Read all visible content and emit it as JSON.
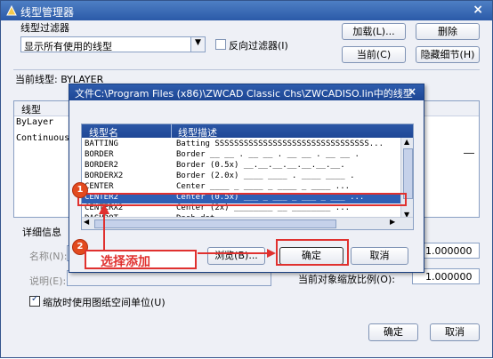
{
  "window": {
    "title": "线型管理器",
    "close_glyph": "×"
  },
  "filter": {
    "group_label": "线型过滤器",
    "selected": "显示所有使用的线型",
    "invert_label": "反向过滤器(I)"
  },
  "buttons": {
    "load": "加载(L)...",
    "delete": "删除",
    "current": "当前(C)",
    "hide_details": "隐藏细节(H)",
    "ok": "确定",
    "cancel": "取消"
  },
  "current_linetype": "当前线型: BYLAYER",
  "main_list": {
    "header": "线型",
    "rows": [
      "ByLayer",
      "Continuous"
    ]
  },
  "details": {
    "group_label": "详细信息",
    "name_label": "名称(N):",
    "desc_label": "说明(E):",
    "global_scale_value": "1.000000",
    "current_scale_label": "当前对象缩放比例(O):",
    "current_scale_value": "1.000000",
    "paper_units_label": "缩放时使用图纸空间单位(U)"
  },
  "dialog": {
    "title": "文件C:\\Program Files (x86)\\ZWCAD Classic Chs\\ZWCADISO.lin中的线型",
    "close_glyph": "×",
    "col_name": "线型名",
    "col_desc": "线型描述",
    "rows": [
      {
        "name": "BATTING",
        "desc": "Batting SSSSSSSSSSSSSSSSSSSSSSSSSSSSSSSS..."
      },
      {
        "name": "BORDER",
        "desc": "Border __ __ . __ __ . __ __ . __ __ ."
      },
      {
        "name": "BORDER2",
        "desc": "Border (0.5x) __.__.__.__.__.__.__."
      },
      {
        "name": "BORDERX2",
        "desc": "Border (2.0x) ____ ____ . ____ ____ ."
      },
      {
        "name": "CENTER",
        "desc": "Center ____ _ ____ _ ____ _ ____ ..."
      },
      {
        "name": "CENTER2",
        "desc": "Center (0.5x) ___ _ ___ _ ___ _ ___ ..."
      },
      {
        "name": "CENTERX2",
        "desc": "Center (2x) ________  __  ________ ..."
      },
      {
        "name": "DASHDOT",
        "desc": "Dash dot __ . __ . __ . __ . __ . __"
      }
    ],
    "selected_index": 5,
    "browse": "浏览(B)...",
    "ok": "确定",
    "cancel": "取消"
  },
  "annotations": {
    "step1": "1",
    "step2": "2",
    "callout": "选择添加",
    "color": "#e0312f"
  }
}
